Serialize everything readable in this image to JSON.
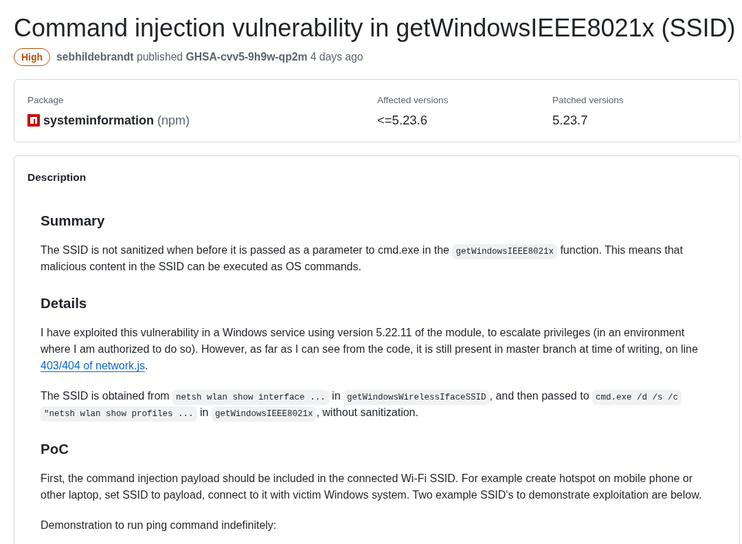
{
  "advisory": {
    "title": "Command injection vulnerability in getWindowsIEEE8021x (SSID)",
    "severity": {
      "label": "High"
    },
    "byline": "**sebhildebrandt** published **GHSA-cvv5-9h9w-qp2m** 4 days ago"
  },
  "package_info": {
    "columns": [
      {
        "kind": "package",
        "label": "Package",
        "value": "systeminformation",
        "ecosystem": "(npm)"
      },
      {
        "kind": "version",
        "label": "Affected versions",
        "value": "<=5.23.6"
      },
      {
        "kind": "version",
        "label": "Patched versions",
        "value": "5.23.7"
      }
    ]
  },
  "description": {
    "title": "Description",
    "sections": [
      {
        "heading": "Summary",
        "paragraphs": [
          [
            {
              "kind": "text",
              "text": "The SSID is not sanitized when before it is passed as a parameter to cmd.exe in the "
            },
            {
              "kind": "code",
              "text": "getWindowsIEEE8021x"
            },
            {
              "kind": "text",
              "text": " function. This means that malicious content in the SSID can be executed as OS commands."
            }
          ]
        ]
      },
      {
        "heading": "Details",
        "paragraphs": [
          [
            {
              "kind": "text",
              "text": "I have exploited this vulnerability in a Windows service using version 5.22.11 of the module, to escalate privileges (in an environment where I am authorized to do so). However, as far as I can see from the code, it is still present in master branch at time of writing, on line "
            },
            {
              "kind": "link",
              "text": "403/404 of network.js"
            },
            {
              "kind": "text",
              "text": "."
            }
          ],
          [
            {
              "kind": "text",
              "text": "The SSID is obtained from "
            },
            {
              "kind": "code",
              "text": "netsh wlan show interface ..."
            },
            {
              "kind": "text",
              "text": " in "
            },
            {
              "kind": "code",
              "text": "getWindowsWirelessIfaceSSID"
            },
            {
              "kind": "text",
              "text": ", and then passed to "
            },
            {
              "kind": "code",
              "text": "cmd.exe /d /s /c \"netsh wlan show profiles ..."
            },
            {
              "kind": "text",
              "text": " in "
            },
            {
              "kind": "code",
              "text": "getWindowsIEEE8021x"
            },
            {
              "kind": "text",
              "text": ", without sanitization."
            }
          ]
        ]
      },
      {
        "heading": "PoC",
        "paragraphs": [
          [
            {
              "kind": "text",
              "text": "First, the command injection payload should be included in the connected Wi-Fi SSID. For example create hotspot on mobile phone or other laptop, set SSID to payload, connect to it with victim Windows system. Two example SSID's to demonstrate exploitation are below."
            }
          ],
          [
            {
              "kind": "text",
              "text": "Demonstration to run ping command indefinitely:"
            }
          ]
        ]
      }
    ]
  }
}
